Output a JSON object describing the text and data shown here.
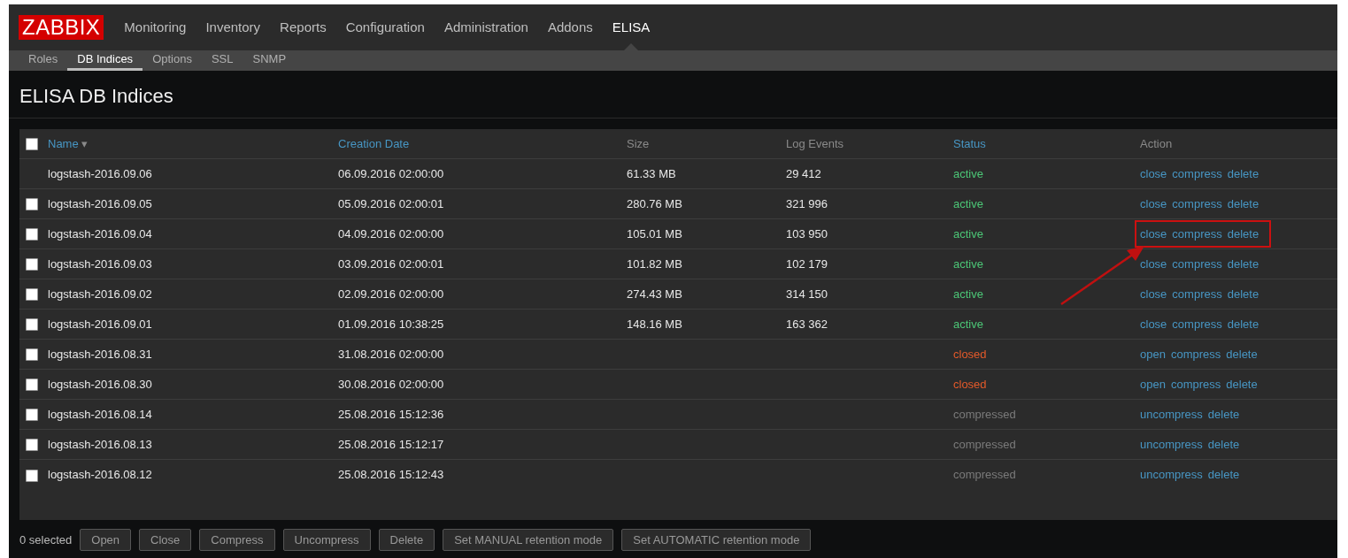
{
  "logo": "ZABBIX",
  "main_menu": [
    {
      "label": "Monitoring",
      "selected": false
    },
    {
      "label": "Inventory",
      "selected": false
    },
    {
      "label": "Reports",
      "selected": false
    },
    {
      "label": "Configuration",
      "selected": false
    },
    {
      "label": "Administration",
      "selected": false
    },
    {
      "label": "Addons",
      "selected": false
    },
    {
      "label": "ELISA",
      "selected": true
    }
  ],
  "sub_menu": [
    {
      "label": "Roles",
      "selected": false
    },
    {
      "label": "DB Indices",
      "selected": true
    },
    {
      "label": "Options",
      "selected": false
    },
    {
      "label": "SSL",
      "selected": false
    },
    {
      "label": "SNMP",
      "selected": false
    }
  ],
  "page_title": "ELISA DB Indices",
  "table": {
    "select_all_checked": false,
    "columns": [
      {
        "label": "Name",
        "sortable": true,
        "sort_arrow": "▾"
      },
      {
        "label": "Creation Date",
        "sortable": true
      },
      {
        "label": "Size",
        "sortable": false
      },
      {
        "label": "Log Events",
        "sortable": false
      },
      {
        "label": "Status",
        "sortable": true
      },
      {
        "label": "Action",
        "sortable": false
      }
    ],
    "rows": [
      {
        "checkbox": false,
        "name": "logstash-2016.09.06",
        "date": "06.09.2016 02:00:00",
        "size": "61.33 MB",
        "events": "29 412",
        "status": "active",
        "color": "#4cc777",
        "actions": [
          "close",
          "compress",
          "delete"
        ],
        "highlighted": false
      },
      {
        "checkbox": true,
        "checked": false,
        "name": "logstash-2016.09.05",
        "date": "05.09.2016 02:00:01",
        "size": "280.76 MB",
        "events": "321 996",
        "status": "active",
        "color": "#4cc777",
        "actions": [
          "close",
          "compress",
          "delete"
        ],
        "highlighted": false
      },
      {
        "checkbox": true,
        "checked": false,
        "name": "logstash-2016.09.04",
        "date": "04.09.2016 02:00:00",
        "size": "105.01 MB",
        "events": "103 950",
        "status": "active",
        "color": "#4cc777",
        "actions": [
          "close",
          "compress",
          "delete"
        ],
        "highlighted": true
      },
      {
        "checkbox": true,
        "checked": false,
        "name": "logstash-2016.09.03",
        "date": "03.09.2016 02:00:01",
        "size": "101.82 MB",
        "events": "102 179",
        "status": "active",
        "color": "#4cc777",
        "actions": [
          "close",
          "compress",
          "delete"
        ],
        "highlighted": false
      },
      {
        "checkbox": true,
        "checked": false,
        "name": "logstash-2016.09.02",
        "date": "02.09.2016 02:00:00",
        "size": "274.43 MB",
        "events": "314 150",
        "status": "active",
        "color": "#4cc777",
        "actions": [
          "close",
          "compress",
          "delete"
        ],
        "highlighted": false
      },
      {
        "checkbox": true,
        "checked": false,
        "name": "logstash-2016.09.01",
        "date": "01.09.2016 10:38:25",
        "size": "148.16 MB",
        "events": "163 362",
        "status": "active",
        "color": "#4cc777",
        "actions": [
          "close",
          "compress",
          "delete"
        ],
        "highlighted": false
      },
      {
        "checkbox": true,
        "checked": false,
        "name": "logstash-2016.08.31",
        "date": "31.08.2016 02:00:00",
        "status": "closed",
        "color": "#e45a2a",
        "actions": [
          "open",
          "compress",
          "delete"
        ],
        "highlighted": false
      },
      {
        "checkbox": true,
        "checked": false,
        "name": "logstash-2016.08.30",
        "date": "30.08.2016 02:00:00",
        "status": "closed",
        "color": "#e45a2a",
        "actions": [
          "open",
          "compress",
          "delete"
        ],
        "highlighted": false
      },
      {
        "checkbox": true,
        "checked": false,
        "name": "logstash-2016.08.14",
        "date": "25.08.2016 15:12:36",
        "status": "compressed",
        "color": "#7a7a7a",
        "actions": [
          "uncompress",
          "delete"
        ],
        "highlighted": false
      },
      {
        "checkbox": true,
        "checked": false,
        "name": "logstash-2016.08.13",
        "date": "25.08.2016 15:12:17",
        "status": "compressed",
        "color": "#7a7a7a",
        "actions": [
          "uncompress",
          "delete"
        ],
        "highlighted": false
      },
      {
        "checkbox": true,
        "checked": false,
        "name": "logstash-2016.08.12",
        "date": "25.08.2016 15:12:43",
        "status": "compressed",
        "color": "#7a7a7a",
        "actions": [
          "uncompress",
          "delete"
        ],
        "highlighted": false
      }
    ]
  },
  "footer": {
    "selected_count": "0 selected",
    "buttons": [
      "Open",
      "Close",
      "Compress",
      "Uncompress",
      "Delete",
      "Set MANUAL retention mode",
      "Set AUTOMATIC retention mode"
    ]
  }
}
